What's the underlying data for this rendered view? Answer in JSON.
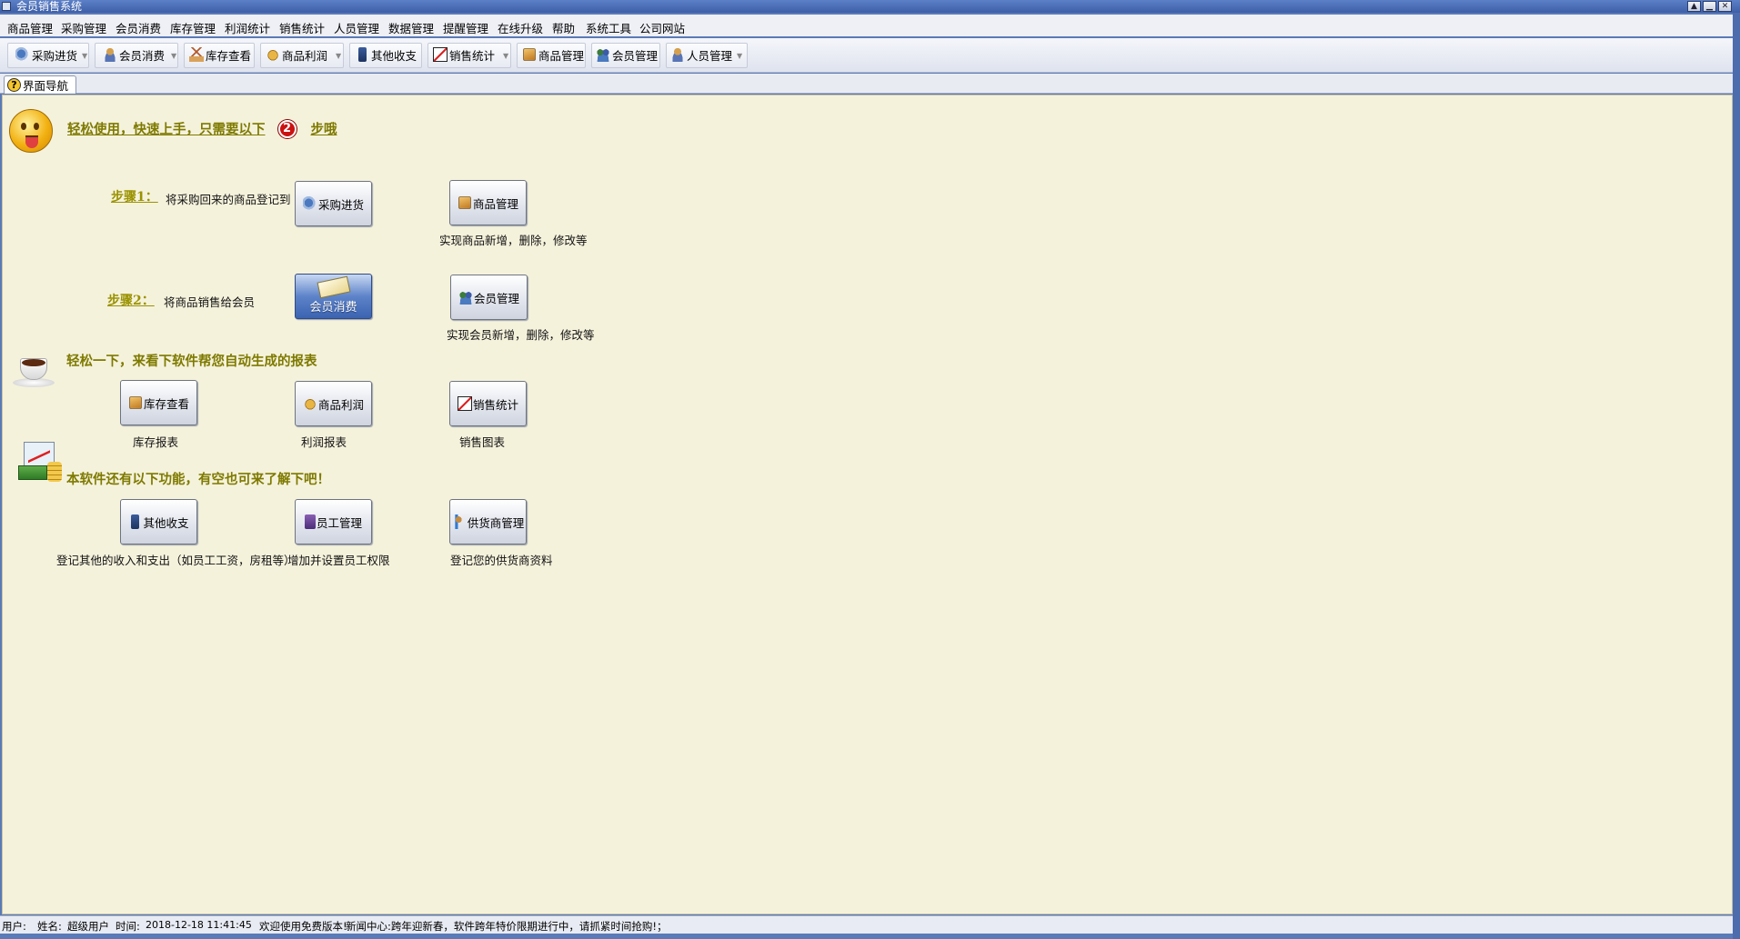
{
  "window": {
    "title": "会员销售系统",
    "controls": [
      "restore",
      "minimize",
      "close"
    ]
  },
  "menubar": {
    "items": [
      "商品管理",
      "采购管理",
      "会员消费",
      "库存管理",
      "利润统计",
      "销售统计",
      "人员管理",
      "数据管理",
      "提醒管理",
      "在线升级",
      "帮助",
      "系统工具",
      "公司网站"
    ]
  },
  "toolbar": {
    "buttons": [
      {
        "label": "采购进货",
        "icon": "purchase-icon"
      },
      {
        "label": "会员消费",
        "icon": "member-consume-icon"
      },
      {
        "label": "库存查看",
        "icon": "inventory-icon"
      },
      {
        "label": "商品利润",
        "icon": "profit-icon"
      },
      {
        "label": "其他收支",
        "icon": "other-income-icon"
      },
      {
        "label": "销售统计",
        "icon": "sales-chart-icon"
      },
      {
        "label": "商品管理",
        "icon": "product-box-icon"
      },
      {
        "label": "会员管理",
        "icon": "members-icon"
      },
      {
        "label": "人员管理",
        "icon": "staff-icon"
      }
    ]
  },
  "tabs": [
    {
      "label": "界面导航",
      "icon": "help-icon",
      "active": true
    }
  ],
  "guide": {
    "intro_before": "轻松使用，快速上手，只需要以下",
    "intro_number": "2",
    "intro_after": "步哦",
    "step1": {
      "link": "步骤1：",
      "text": "将采购回来的商品登记到",
      "button": "采购进货",
      "extra_button": "商品管理",
      "extra_caption": "实现商品新增，删除，修改等"
    },
    "step2": {
      "link": "步骤2：",
      "text": "将商品销售给会员",
      "button": "会员消费",
      "extra_button": "会员管理",
      "extra_caption": "实现会员新增，删除，修改等"
    },
    "reports": {
      "heading": "轻松一下，来看下软件帮您自动生成的报表",
      "items": [
        {
          "button": "库存查看",
          "caption": "库存报表"
        },
        {
          "button": "商品利润",
          "caption": "利润报表"
        },
        {
          "button": "销售统计",
          "caption": "销售图表"
        }
      ]
    },
    "more": {
      "heading": "本软件还有以下功能，有空也可来了解下吧！",
      "items": [
        {
          "button": "其他收支",
          "caption": "登记其他的收入和支出（如员工工资，房租等）"
        },
        {
          "button": "员工管理",
          "caption": "增加并设置员工权限"
        },
        {
          "button": "供货商管理",
          "caption": "登记您的供货商资料"
        }
      ]
    }
  },
  "statusbar": {
    "user_label": "用户:",
    "name_label": "姓名:",
    "name_value": "超级用户",
    "time_label": "时间:",
    "time_value": "2018-12-18 11:41:45",
    "welcome": "欢迎使用免费版本!",
    "news": "新闻中心:跨年迎新春，软件跨年特价限期进行中，请抓紧时间抢购!；"
  },
  "colors": {
    "content_bg": "#f5f2dc",
    "heading_olive": "#7e7a00",
    "title_blue": "#3d5fa7",
    "badge_red": "#cc1111"
  }
}
